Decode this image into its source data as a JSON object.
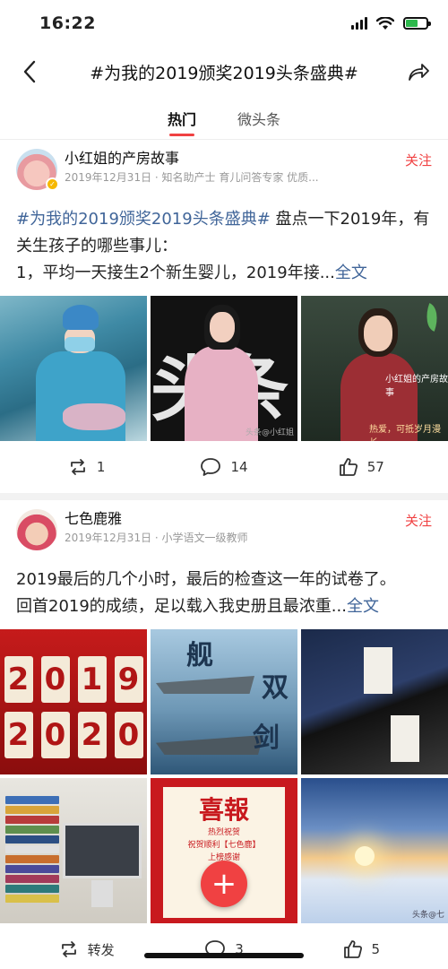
{
  "status_bar": {
    "time": "16:22"
  },
  "header": {
    "title": "#为我的2019颁奖2019头条盛典#",
    "back_icon": "chevron-left-icon",
    "share_icon": "share-arrow-icon"
  },
  "tabs": [
    {
      "label": "热门",
      "active": true
    },
    {
      "label": "微头条",
      "active": false
    }
  ],
  "posts": [
    {
      "author": "小红姐的产房故事",
      "meta": "2019年12月31日 · 知名助产士 育儿问答专家 优质...",
      "follow_label": "关注",
      "text": {
        "hashtag": "#为我的2019颁奖2019头条盛典#",
        "line1_rest": "盘点一下2019年，有关生孩子的哪些事儿：",
        "line2": "1，平均一天接生2个新生婴儿，2019年接...",
        "more": "全文"
      },
      "images": {
        "img2_wm": "头条@小红姐",
        "img3_caption1": "小红姐的产房故事",
        "img3_caption2": "热爱，可抵岁月漫长"
      },
      "actions": {
        "repost_count": "1",
        "comment_count": "14",
        "like_count": "57"
      }
    },
    {
      "author": "七色鹿雅",
      "meta": "2019年12月31日 · 小学语文一级教师",
      "follow_label": "关注",
      "text": {
        "line1": "2019最后的几个小时，最后的检查这一年的试卷了。",
        "line2": "回首2019的成绩，足以载入我史册且最浓重...",
        "more": "全文"
      },
      "images": {
        "countdown_top": [
          "2",
          "0",
          "1",
          "9"
        ],
        "countdown_bottom": [
          "2",
          "0",
          "2",
          "0"
        ],
        "carrier_t1": "舰",
        "carrier_t2": "双",
        "carrier_t3": "剑",
        "poster_head": "喜報",
        "poster_sub": "热烈祝贺\n祝贺顺利【七色鹿】\n上榜感谢",
        "snow_wm": "头条@七"
      },
      "actions": {
        "repost_label": "转发",
        "comment_count": "3",
        "like_count": "5"
      }
    }
  ],
  "colors": {
    "accent": "#f04142",
    "link": "#406599",
    "meta": "#999999"
  }
}
